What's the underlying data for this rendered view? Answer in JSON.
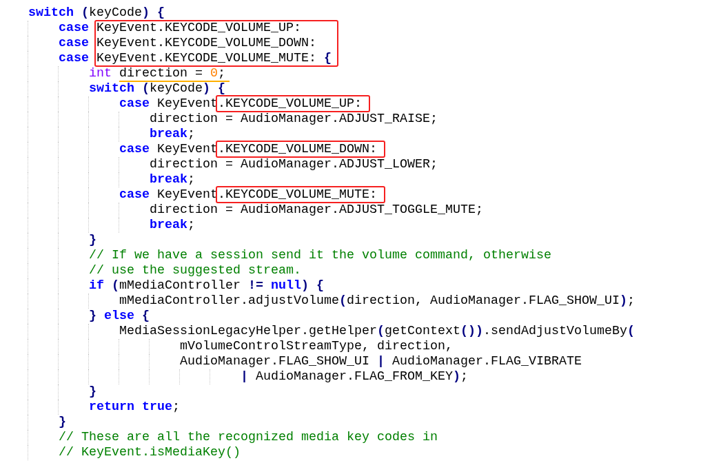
{
  "code_lines": [
    {
      "kind": "statement",
      "tokens": [
        {
          "kind": "keyword",
          "text": "switch"
        },
        {
          "kind": "punct",
          "text": " ("
        },
        {
          "kind": "plain",
          "text": "keyCode"
        },
        {
          "kind": "punct",
          "text": ")"
        },
        {
          "kind": "punct",
          "text": " {"
        }
      ],
      "children": [
        {
          "kind": "statement",
          "tokens": [
            {
              "kind": "keyword",
              "text": "case "
            },
            {
              "kind": "box",
              "tokens": [
                {
                  "kind": "plain",
                  "text": "KeyEvent.KEYCODE_VOLUME_UP:"
                }
              ]
            }
          ]
        },
        {
          "kind": "statement",
          "tokens": [
            {
              "kind": "keyword",
              "text": "case "
            },
            {
              "kind": "box",
              "tokens": [
                {
                  "kind": "plain",
                  "text": "KeyEvent.KEYCODE_VOLUME_DOWN:"
                }
              ]
            }
          ]
        },
        {
          "kind": "statement",
          "tokens": [
            {
              "kind": "keyword",
              "text": "case "
            },
            {
              "kind": "box",
              "tokens": [
                {
                  "kind": "plain",
                  "text": "KeyEvent.KEYCODE_VOLUME_MUTE:"
                },
                {
                  "kind": "punct",
                  "text": " {"
                }
              ]
            }
          ],
          "children": [
            {
              "kind": "statement",
              "tokens": [
                {
                  "kind": "type",
                  "text": "int "
                },
                {
                  "kind": "underline",
                  "tokens": [
                    {
                      "kind": "plain",
                      "text": "direction = "
                    },
                    {
                      "kind": "number",
                      "text": "0"
                    },
                    {
                      "kind": "plain",
                      "text": ";"
                    }
                  ]
                }
              ]
            },
            {
              "kind": "statement",
              "tokens": [
                {
                  "kind": "keyword",
                  "text": "switch"
                },
                {
                  "kind": "punct",
                  "text": " ("
                },
                {
                  "kind": "plain",
                  "text": "keyCode"
                },
                {
                  "kind": "punct",
                  "text": ")"
                },
                {
                  "kind": "punct",
                  "text": " {"
                }
              ],
              "children": [
                {
                  "kind": "statement",
                  "tokens": [
                    {
                      "kind": "keyword",
                      "text": "case"
                    },
                    {
                      "kind": "plain",
                      "text": " KeyEvent"
                    },
                    {
                      "kind": "box",
                      "tokens": [
                        {
                          "kind": "plain",
                          "text": ".KEYCODE_VOLUME_UP:"
                        }
                      ]
                    }
                  ],
                  "children": [
                    {
                      "kind": "statement",
                      "tokens": [
                        {
                          "kind": "plain",
                          "text": "direction = AudioManager.ADJUST_RAISE;"
                        }
                      ]
                    },
                    {
                      "kind": "statement",
                      "tokens": [
                        {
                          "kind": "keyword",
                          "text": "break"
                        },
                        {
                          "kind": "plain",
                          "text": ";"
                        }
                      ]
                    }
                  ]
                },
                {
                  "kind": "statement",
                  "tokens": [
                    {
                      "kind": "keyword",
                      "text": "case"
                    },
                    {
                      "kind": "plain",
                      "text": " KeyEvent"
                    },
                    {
                      "kind": "box",
                      "tokens": [
                        {
                          "kind": "plain",
                          "text": ".KEYCODE_VOLUME_DOWN:"
                        }
                      ]
                    }
                  ],
                  "children": [
                    {
                      "kind": "statement",
                      "tokens": [
                        {
                          "kind": "plain",
                          "text": "direction = AudioManager.ADJUST_LOWER;"
                        }
                      ]
                    },
                    {
                      "kind": "statement",
                      "tokens": [
                        {
                          "kind": "keyword",
                          "text": "break"
                        },
                        {
                          "kind": "plain",
                          "text": ";"
                        }
                      ]
                    }
                  ]
                },
                {
                  "kind": "statement",
                  "tokens": [
                    {
                      "kind": "keyword",
                      "text": "case"
                    },
                    {
                      "kind": "plain",
                      "text": " KeyEvent"
                    },
                    {
                      "kind": "box",
                      "tokens": [
                        {
                          "kind": "plain",
                          "text": ".KEYCODE_VOLUME_MUTE:"
                        }
                      ]
                    }
                  ],
                  "children": [
                    {
                      "kind": "statement",
                      "tokens": [
                        {
                          "kind": "plain",
                          "text": "direction = AudioManager.ADJUST_TOGGLE_MUTE;"
                        }
                      ]
                    },
                    {
                      "kind": "statement",
                      "tokens": [
                        {
                          "kind": "keyword",
                          "text": "break"
                        },
                        {
                          "kind": "plain",
                          "text": ";"
                        }
                      ]
                    }
                  ]
                }
              ]
            },
            {
              "kind": "statement",
              "tokens": [
                {
                  "kind": "punct",
                  "text": "}"
                }
              ]
            },
            {
              "kind": "statement",
              "tokens": [
                {
                  "kind": "comment",
                  "text": "// If we have a session send it the volume command, otherwise"
                }
              ]
            },
            {
              "kind": "statement",
              "tokens": [
                {
                  "kind": "comment",
                  "text": "// use the suggested stream."
                }
              ]
            },
            {
              "kind": "statement",
              "tokens": [
                {
                  "kind": "keyword",
                  "text": "if"
                },
                {
                  "kind": "punct",
                  "text": " ("
                },
                {
                  "kind": "plain",
                  "text": "mMediaController "
                },
                {
                  "kind": "punct",
                  "text": "!= "
                },
                {
                  "kind": "keyword",
                  "text": "null"
                },
                {
                  "kind": "punct",
                  "text": ")"
                },
                {
                  "kind": "punct",
                  "text": " {"
                }
              ],
              "children": [
                {
                  "kind": "statement",
                  "tokens": [
                    {
                      "kind": "plain",
                      "text": "mMediaController.adjustVolume"
                    },
                    {
                      "kind": "punct",
                      "text": "("
                    },
                    {
                      "kind": "plain",
                      "text": "direction, AudioManager.FLAG_SHOW_UI"
                    },
                    {
                      "kind": "punct",
                      "text": ")"
                    },
                    {
                      "kind": "plain",
                      "text": ";"
                    }
                  ]
                }
              ]
            },
            {
              "kind": "statement",
              "tokens": [
                {
                  "kind": "punct",
                  "text": "} "
                },
                {
                  "kind": "keyword",
                  "text": "else"
                },
                {
                  "kind": "punct",
                  "text": " {"
                }
              ],
              "children": [
                {
                  "kind": "statement",
                  "tokens": [
                    {
                      "kind": "plain",
                      "text": "MediaSessionLegacyHelper.getHelper"
                    },
                    {
                      "kind": "punct",
                      "text": "("
                    },
                    {
                      "kind": "plain",
                      "text": "getContext"
                    },
                    {
                      "kind": "punct",
                      "text": "())"
                    },
                    {
                      "kind": "plain",
                      "text": ".sendAdjustVolumeBy"
                    },
                    {
                      "kind": "punct",
                      "text": "("
                    }
                  ],
                  "children": [
                    {
                      "kind": "continuation",
                      "tokens": [
                        {
                          "kind": "plain",
                          "text": "mVolumeControlStreamType, direction,"
                        }
                      ]
                    },
                    {
                      "kind": "continuation",
                      "tokens": [
                        {
                          "kind": "plain",
                          "text": "AudioManager.FLAG_SHOW_UI "
                        },
                        {
                          "kind": "punct",
                          "text": "|"
                        },
                        {
                          "kind": "plain",
                          "text": " AudioManager.FLAG_VIBRATE"
                        }
                      ],
                      "children": [
                        {
                          "kind": "continuation",
                          "tokens": [
                            {
                              "kind": "punct",
                              "text": "|"
                            },
                            {
                              "kind": "plain",
                              "text": " AudioManager.FLAG_FROM_KEY"
                            },
                            {
                              "kind": "punct",
                              "text": ")"
                            },
                            {
                              "kind": "plain",
                              "text": ";"
                            }
                          ]
                        }
                      ]
                    }
                  ]
                }
              ]
            },
            {
              "kind": "statement",
              "tokens": [
                {
                  "kind": "punct",
                  "text": "}"
                }
              ]
            },
            {
              "kind": "statement",
              "tokens": [
                {
                  "kind": "keyword",
                  "text": "return"
                },
                {
                  "kind": "keyword",
                  "text": " true"
                },
                {
                  "kind": "plain",
                  "text": ";"
                }
              ]
            }
          ]
        },
        {
          "kind": "statement",
          "tokens": [
            {
              "kind": "punct",
              "text": "}"
            }
          ]
        },
        {
          "kind": "statement",
          "tokens": [
            {
              "kind": "comment",
              "text": "// These are all the recognized media key codes in"
            }
          ]
        },
        {
          "kind": "statement",
          "tokens": [
            {
              "kind": "comment",
              "text": "// KeyEvent.isMediaKey()"
            }
          ]
        }
      ]
    }
  ]
}
